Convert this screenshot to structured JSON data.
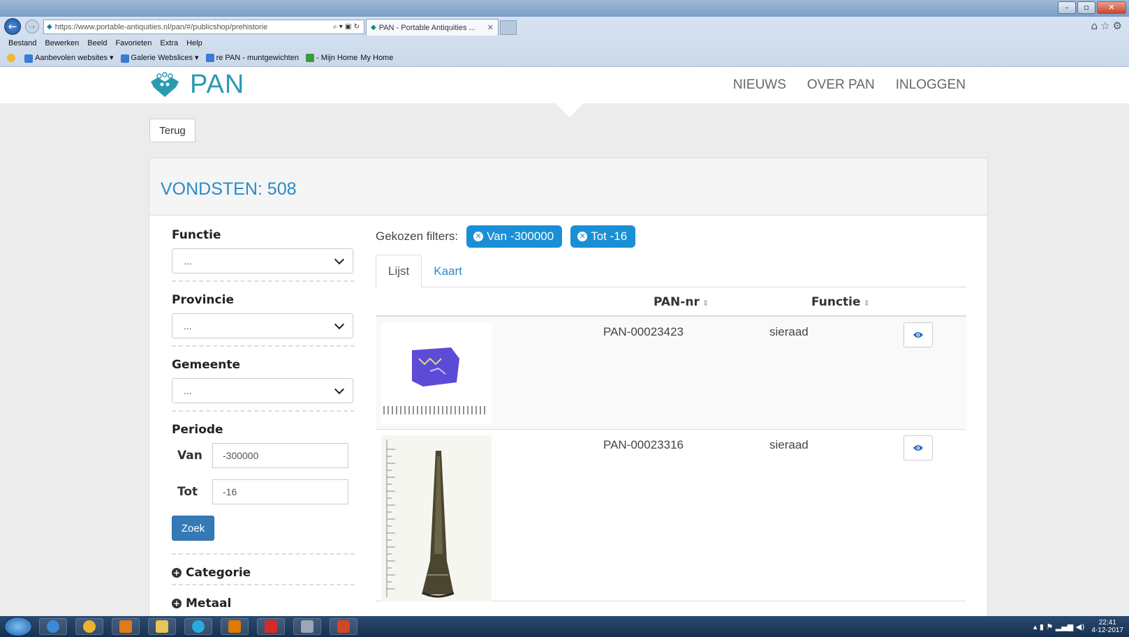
{
  "browser": {
    "url": "https://www.portable-antiquities.nl/pan/#/publicshop/prehistorie",
    "tab_title": "PAN - Portable Antiquities ...",
    "menu": [
      "Bestand",
      "Bewerken",
      "Beeld",
      "Favorieten",
      "Extra",
      "Help"
    ],
    "favorites": [
      "Aanbevolen websites ▾",
      "Galerie Webslices ▾",
      "re PAN - muntgewichten",
      "- Mijn Home",
      "My Home"
    ]
  },
  "site": {
    "logo_text": "PAN",
    "nav": [
      "NIEUWS",
      "OVER PAN",
      "INLOGGEN"
    ],
    "back_label": "Terug",
    "results_title": "VONDSTEN: 508",
    "brand_color": "#2a9ab0"
  },
  "sidebar": {
    "functie": {
      "label": "Functie",
      "value": "..."
    },
    "provincie": {
      "label": "Provincie",
      "value": "..."
    },
    "gemeente": {
      "label": "Gemeente",
      "value": "..."
    },
    "periode": {
      "label": "Periode",
      "van_label": "Van",
      "van_value": "-300000",
      "tot_label": "Tot",
      "tot_value": "-16"
    },
    "search_label": "Zoek",
    "categorie": "Categorie",
    "metaal": "Metaal"
  },
  "main": {
    "chosen_label": "Gekozen filters:",
    "chips": [
      "Van -300000",
      "Tot -16"
    ],
    "tabs": [
      "Lijst",
      "Kaart"
    ],
    "active_tab": "Lijst",
    "columns": {
      "pannr": "PAN-nr",
      "functie": "Functie"
    },
    "rows": [
      {
        "pannr": "PAN-00023423",
        "functie": "sieraad"
      },
      {
        "pannr": "PAN-00023316",
        "functie": "sieraad"
      }
    ]
  },
  "taskbar": {
    "time": "22:41",
    "date": "4-12-2017"
  }
}
